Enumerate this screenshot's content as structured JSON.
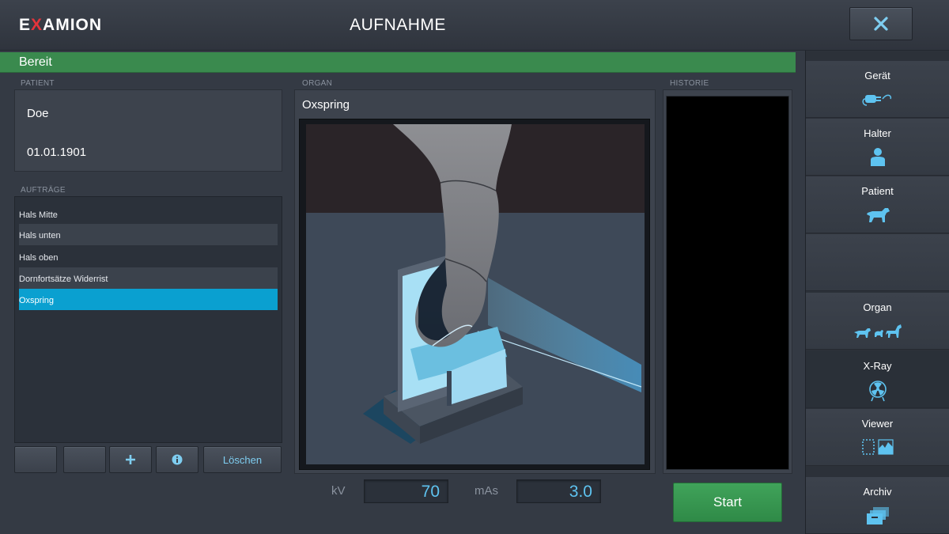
{
  "header": {
    "logo_prefix": "E",
    "logo_x": "X",
    "logo_suffix": "AMION",
    "title": "AUFNAHME",
    "close_icon": "close-icon"
  },
  "status": {
    "text": "Bereit",
    "color": "#3a8a4e"
  },
  "patient": {
    "section_label": "PATIENT",
    "name": "Doe",
    "birthdate": "01.01.1901"
  },
  "orders": {
    "section_label": "AUFTRÄGE",
    "items": [
      {
        "label": "Hals Mitte"
      },
      {
        "label": "Hals unten"
      },
      {
        "label": "Hals oben"
      },
      {
        "label": "Dornfortsätze Widerrist"
      },
      {
        "label": "Oxspring"
      }
    ],
    "selected_label": "Oxspring"
  },
  "toolbar": {
    "add_icon": "plus-icon",
    "info_icon": "info-icon",
    "delete_label": "Löschen"
  },
  "organ": {
    "section_label": "ORGAN",
    "name": "Oxspring",
    "illustration": "horse-hoof-xray-positioning-illustration"
  },
  "history": {
    "section_label": "HISTORIE"
  },
  "parameters": {
    "kv_label": "kV",
    "kv_value": "70",
    "mas_label": "mAs",
    "mas_value": "3.0"
  },
  "start_label": "Start",
  "colors": {
    "accent": "#0aa0d0",
    "value_text": "#5ec3f0",
    "start": "#3a9a52",
    "logo_accent": "#e3343b"
  },
  "sidebar": {
    "items": [
      {
        "label": "Gerät",
        "icon": "device-plug-icon"
      },
      {
        "label": "Halter",
        "icon": "owner-person-icon"
      },
      {
        "label": "Patient",
        "icon": "dog-icon"
      },
      {
        "label": "Organ",
        "icon": "animals-icon"
      },
      {
        "label": "X-Ray",
        "icon": "radiation-icon",
        "active": true
      },
      {
        "label": "Viewer",
        "icon": "viewer-icon"
      },
      {
        "label": "Archiv",
        "icon": "archive-icon"
      }
    ]
  }
}
